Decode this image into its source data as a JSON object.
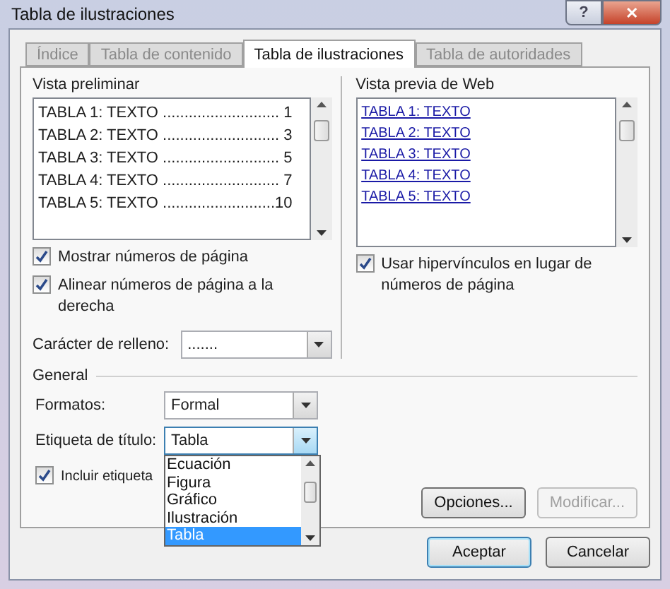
{
  "window": {
    "title": "Tabla de ilustraciones",
    "help_button": "?",
    "close_button": "✕"
  },
  "tabs": [
    {
      "label": "Índice",
      "selected": false
    },
    {
      "label": "Tabla de contenido",
      "selected": false
    },
    {
      "label": "Tabla de ilustraciones",
      "selected": true
    },
    {
      "label": "Tabla de autoridades",
      "selected": false
    }
  ],
  "print_preview": {
    "label": "Vista preliminar",
    "entries": [
      "TABLA 1: TEXTO ........................... 1",
      "TABLA 2: TEXTO ........................... 3",
      "TABLA 3: TEXTO ........................... 5",
      "TABLA 4: TEXTO ........................... 7",
      "TABLA 5: TEXTO ..........................10"
    ]
  },
  "web_preview": {
    "label": "Vista previa de Web",
    "entries": [
      "TABLA 1: TEXTO",
      "TABLA 2: TEXTO",
      "TABLA 3: TEXTO",
      "TABLA 4: TEXTO",
      "TABLA 5: TEXTO"
    ]
  },
  "left_options": [
    {
      "label": "Mostrar números de página",
      "checked": true
    },
    {
      "label": "Alinear números de página a la derecha",
      "checked": true
    }
  ],
  "tab_leader": {
    "label": "Carácter de relleno:",
    "value": "......."
  },
  "right_options": [
    {
      "label": "Usar hipervínculos en lugar de números de página",
      "checked": true
    }
  ],
  "general": {
    "label": "General",
    "formats": {
      "label": "Formatos:",
      "value": "Formal"
    },
    "caption_label": {
      "label": "Etiqueta de título:",
      "value": "Tabla",
      "expanded": true,
      "options": [
        {
          "label": "Ecuación",
          "selected": false
        },
        {
          "label": "Figura",
          "selected": false
        },
        {
          "label": "Gráfico",
          "selected": false
        },
        {
          "label": "Ilustración",
          "selected": false
        },
        {
          "label": "Tabla",
          "selected": true
        }
      ]
    },
    "include_label": {
      "label": "Incluir etiqueta",
      "checked": true
    }
  },
  "buttons": [
    {
      "label": "Opciones...",
      "disabled": false
    },
    {
      "label": "Modificar...",
      "disabled": true
    }
  ],
  "footer_buttons": [
    {
      "label": "Aceptar",
      "default": true
    },
    {
      "label": "Cancelar",
      "default": false
    }
  ]
}
